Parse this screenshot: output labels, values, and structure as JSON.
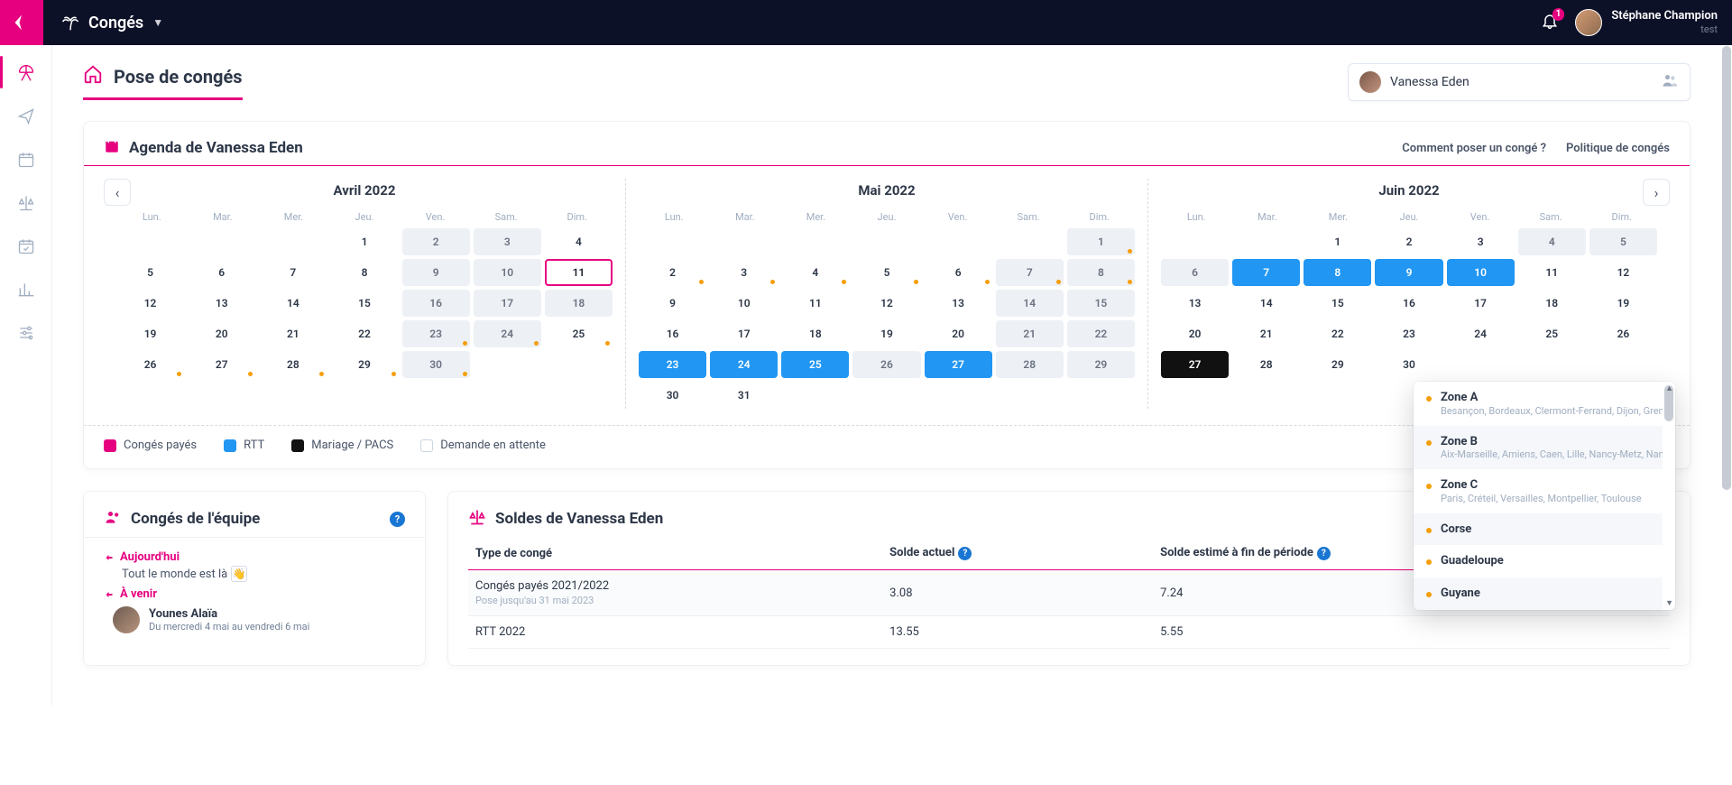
{
  "topbar": {
    "app_title": "Congés",
    "notif_count": "1",
    "user_name": "Stéphane Champion",
    "user_sub": "test"
  },
  "page": {
    "title": "Pose de congés",
    "person": "Vanessa Eden"
  },
  "agenda": {
    "title": "Agenda de Vanessa Eden",
    "link_howto": "Comment poser un congé ?",
    "link_policy": "Politique de congés",
    "dow": [
      "Lun.",
      "Mar.",
      "Mer.",
      "Jeu.",
      "Ven.",
      "Sam.",
      "Dim."
    ],
    "months": [
      {
        "title": "Avril 2022",
        "lead_blanks": 3,
        "days": [
          {
            "n": "1"
          },
          {
            "n": "2",
            "off": true
          },
          {
            "n": "3",
            "off": true
          },
          {
            "n": "4"
          },
          {
            "n": "5"
          },
          {
            "n": "6"
          },
          {
            "n": "7"
          },
          {
            "n": "8"
          },
          {
            "n": "9",
            "off": true
          },
          {
            "n": "10",
            "off": true
          },
          {
            "n": "11",
            "today": true
          },
          {
            "n": "12"
          },
          {
            "n": "13"
          },
          {
            "n": "14"
          },
          {
            "n": "15"
          },
          {
            "n": "16",
            "off": true
          },
          {
            "n": "17",
            "off": true
          },
          {
            "n": "18",
            "off": true
          },
          {
            "n": "19"
          },
          {
            "n": "20"
          },
          {
            "n": "21"
          },
          {
            "n": "22"
          },
          {
            "n": "23",
            "off": true,
            "dot": true
          },
          {
            "n": "24",
            "off": true,
            "dot": true
          },
          {
            "n": "25",
            "dot": true
          },
          {
            "n": "26",
            "dot": true
          },
          {
            "n": "27",
            "dot": true
          },
          {
            "n": "28",
            "dot": true
          },
          {
            "n": "29",
            "dot": true
          },
          {
            "n": "30",
            "off": true,
            "dot": true
          }
        ]
      },
      {
        "title": "Mai 2022",
        "lead_blanks": 6,
        "days": [
          {
            "n": "1",
            "off": true,
            "dot": true
          },
          {
            "n": "2",
            "dot": true
          },
          {
            "n": "3",
            "dot": true
          },
          {
            "n": "4",
            "dot": true
          },
          {
            "n": "5",
            "dot": true
          },
          {
            "n": "6",
            "dot": true
          },
          {
            "n": "7",
            "off": true,
            "dot": true
          },
          {
            "n": "8",
            "off": true,
            "dot": true
          },
          {
            "n": "9"
          },
          {
            "n": "10"
          },
          {
            "n": "11"
          },
          {
            "n": "12"
          },
          {
            "n": "13"
          },
          {
            "n": "14",
            "off": true
          },
          {
            "n": "15",
            "off": true
          },
          {
            "n": "16"
          },
          {
            "n": "17"
          },
          {
            "n": "18"
          },
          {
            "n": "19"
          },
          {
            "n": "20"
          },
          {
            "n": "21",
            "off": true
          },
          {
            "n": "22",
            "off": true
          },
          {
            "n": "23",
            "rtt": true
          },
          {
            "n": "24",
            "rtt": true
          },
          {
            "n": "25",
            "rtt": true
          },
          {
            "n": "26",
            "off": true
          },
          {
            "n": "27",
            "rtt": true
          },
          {
            "n": "28",
            "off": true
          },
          {
            "n": "29",
            "off": true
          },
          {
            "n": "30"
          },
          {
            "n": "31"
          }
        ]
      },
      {
        "title": "Juin 2022",
        "lead_blanks": 2,
        "days": [
          {
            "n": "1"
          },
          {
            "n": "2"
          },
          {
            "n": "3"
          },
          {
            "n": "4",
            "off": true
          },
          {
            "n": "5",
            "off": true
          },
          {
            "n": "6",
            "off": true
          },
          {
            "n": "7",
            "rtt": true
          },
          {
            "n": "8",
            "rtt": true
          },
          {
            "n": "9",
            "rtt": true
          },
          {
            "n": "10",
            "rtt": true
          },
          {
            "n": "11"
          },
          {
            "n": "12"
          },
          {
            "n": "13"
          },
          {
            "n": "14"
          },
          {
            "n": "15"
          },
          {
            "n": "16"
          },
          {
            "n": "17"
          },
          {
            "n": "18"
          },
          {
            "n": "19"
          },
          {
            "n": "20"
          },
          {
            "n": "21"
          },
          {
            "n": "22"
          },
          {
            "n": "23"
          },
          {
            "n": "24"
          },
          {
            "n": "25"
          },
          {
            "n": "26"
          },
          {
            "n": "27",
            "mpacs": true
          },
          {
            "n": "28"
          },
          {
            "n": "29"
          },
          {
            "n": "30"
          }
        ]
      }
    ],
    "legend": {
      "cp": "Congés payés",
      "rtt": "RTT",
      "mpacs": "Mariage / PACS",
      "pending": "Demande en attente"
    }
  },
  "zones": [
    {
      "name": "Zone A",
      "desc": "Besançon, Bordeaux, Clermont-Ferrand, Dijon, Grenoble,"
    },
    {
      "name": "Zone B",
      "desc": "Aix-Marseille, Amiens, Caen, Lille, Nancy-Metz, Nantes, N"
    },
    {
      "name": "Zone C",
      "desc": "Paris, Créteil, Versailles, Montpellier, Toulouse"
    },
    {
      "name": "Corse",
      "desc": ""
    },
    {
      "name": "Guadeloupe",
      "desc": ""
    },
    {
      "name": "Guyane",
      "desc": ""
    }
  ],
  "team": {
    "title": "Congés de l'équipe",
    "today_label": "Aujourd'hui",
    "today_text": "Tout le monde est là",
    "upcoming_label": "À venir",
    "person_name": "Younes Alaïa",
    "person_dates": "Du mercredi 4 mai au vendredi 6 mai"
  },
  "balances": {
    "title": "Soldes de Vanessa Eden",
    "col_type": "Type de congé",
    "col_current": "Solde actuel",
    "col_eop": "Solde estimé à fin de période",
    "rows": [
      {
        "type": "Congés payés 2021/2022",
        "note": "Pose jusqu'au 31 mai 2023",
        "current": "3.08",
        "eop": "7.24"
      },
      {
        "type": "RTT 2022",
        "note": "",
        "current": "13.55",
        "eop": "5.55"
      }
    ]
  }
}
